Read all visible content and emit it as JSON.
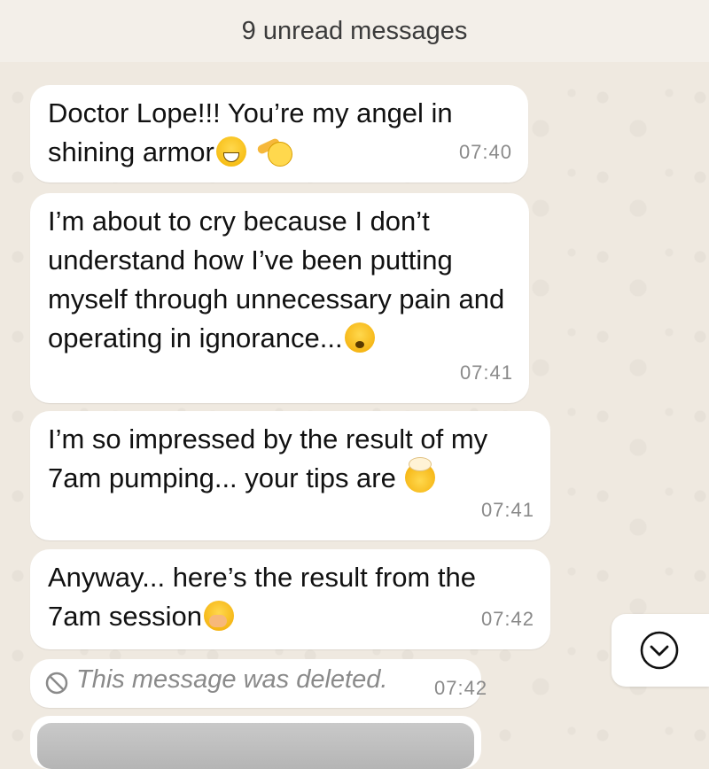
{
  "banner": {
    "unread_text": "9 unread messages"
  },
  "messages": [
    {
      "text": "Doctor Lope!!! You’re my angel in shining armor",
      "time": "07:40",
      "emojis": [
        "grinning-sweat",
        "saluting-face"
      ]
    },
    {
      "text": "I’m about to cry because I don’t understand how I’ve been putting myself through unnecessary pain and operating in ignorance...",
      "time": "07:41",
      "emojis": [
        "worried-face"
      ]
    },
    {
      "text": "I’m so impressed by the result of my 7am pumping... your tips are",
      "time": "07:41",
      "emojis": [
        "exploding-head"
      ]
    },
    {
      "text": "Anyway... here’s the result from the 7am session",
      "time": "07:42",
      "emojis": [
        "face-with-hand-over-mouth"
      ]
    }
  ],
  "deleted_message": {
    "text": "This message was deleted.",
    "time": "07:42",
    "icon": "ban-icon"
  },
  "scroll_button": {
    "icon": "chevron-down-icon"
  },
  "colors": {
    "bubble": "#ffffff",
    "timestamp": "#8a8a8a",
    "wallpaper": "#efe9e0"
  }
}
